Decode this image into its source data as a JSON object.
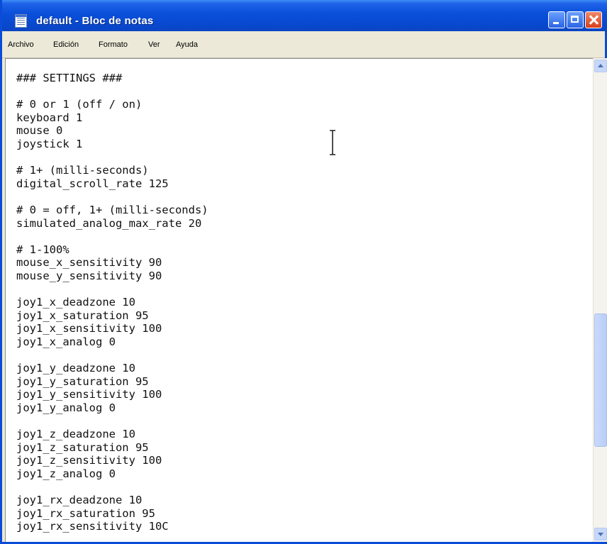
{
  "window": {
    "title": "default - Bloc de notas",
    "app_icon": "notepad-icon",
    "controls": [
      "minimize-icon",
      "maximize-icon",
      "close-icon"
    ]
  },
  "menu": {
    "items": [
      "Archivo",
      "Edición",
      "Formato",
      "Ver",
      "Ayuda"
    ]
  },
  "editor": {
    "lines": [
      "### SETTINGS ###",
      "",
      "# 0 or 1 (off / on)",
      "keyboard 1",
      "mouse 0",
      "joystick 1",
      "",
      "# 1+ (milli-seconds)",
      "digital_scroll_rate 125",
      "",
      "# 0 = off, 1+ (milli-seconds)",
      "simulated_analog_max_rate 20",
      "",
      "# 1-100%",
      "mouse_x_sensitivity 90",
      "mouse_y_sensitivity 90",
      "",
      "joy1_x_deadzone 10",
      "joy1_x_saturation 95",
      "joy1_x_sensitivity 100",
      "joy1_x_analog 0",
      "",
      "joy1_y_deadzone 10",
      "joy1_y_saturation 95",
      "joy1_y_sensitivity 100",
      "joy1_y_analog 0",
      "",
      "joy1_z_deadzone 10",
      "joy1_z_saturation 95",
      "joy1_z_sensitivity 100",
      "joy1_z_analog 0",
      "",
      "joy1_rx_deadzone 10",
      "joy1_rx_saturation 95",
      "joy1_rx_sensitivity 10C"
    ]
  },
  "colors": {
    "titlebar": "#0a4fd9",
    "close_button": "#d6401b",
    "menubar": "#ece9d8",
    "text": "#111111"
  }
}
